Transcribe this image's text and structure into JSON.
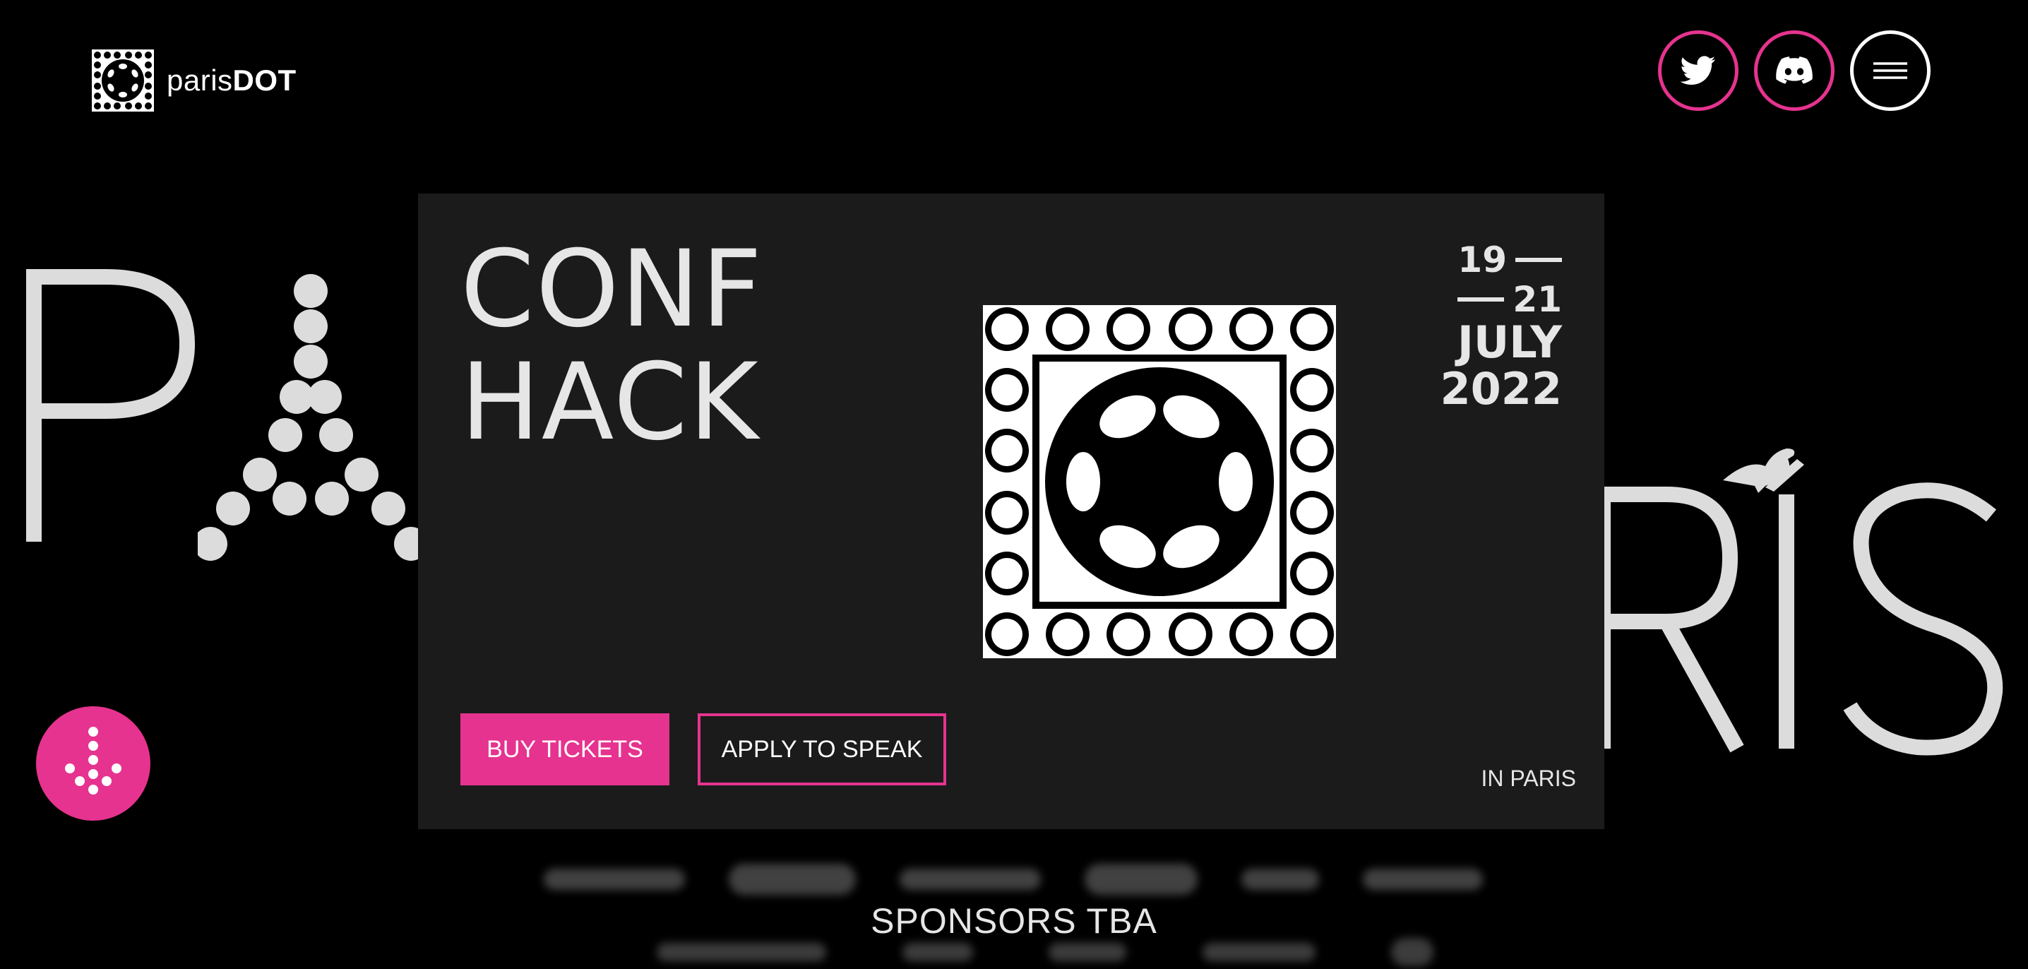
{
  "brand": {
    "name_prefix": "paris",
    "name_suffix": "DOT"
  },
  "header": {
    "twitter_label": "Twitter",
    "discord_label": "Discord",
    "menu_label": "Menu"
  },
  "hero": {
    "title_line1": "CONF",
    "title_line2": "HACK",
    "date_start": "19",
    "date_end": "21",
    "month": "JULY",
    "year": "2022",
    "buy_tickets": "BUY TICKETS",
    "apply_to_speak": "APPLY TO SPEAK",
    "location": "IN PARIS"
  },
  "sponsors": {
    "label": "SPONSORS TBA"
  },
  "theme": {
    "accent": "#e6338f",
    "background": "#000000",
    "card": "#1b1b1b",
    "text_light": "#e6e6e6"
  },
  "icons": {
    "twitter": "twitter-icon",
    "discord": "discord-icon",
    "menu": "hamburger-icon",
    "scroll": "scroll-down-icon",
    "logo": "polkadot-logo"
  }
}
